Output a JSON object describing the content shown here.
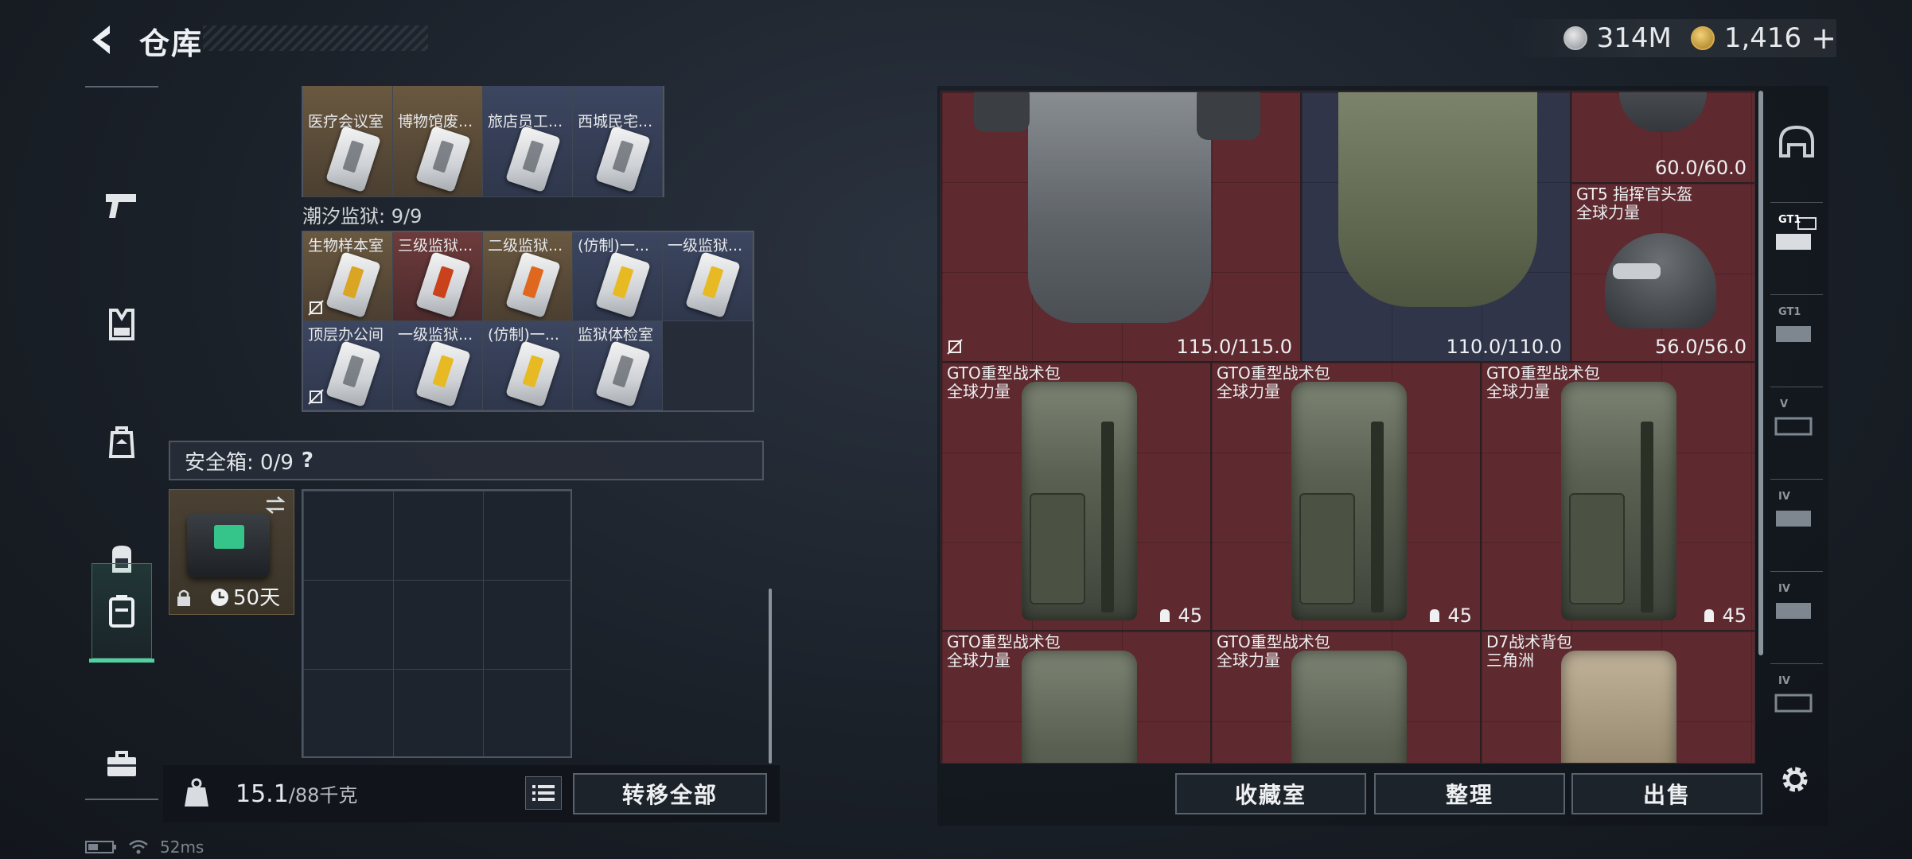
{
  "header": {
    "title": "仓库",
    "currency": [
      {
        "icon": "silver-coin-icon",
        "value": "314M"
      },
      {
        "icon": "gold-coin-icon",
        "value": "1,416"
      },
      {
        "icon": "plus-icon",
        "value": "+"
      }
    ]
  },
  "left_nav": [
    {
      "icon": "pistol-icon"
    },
    {
      "icon": "vest-icon"
    },
    {
      "icon": "chest-rig-icon"
    },
    {
      "icon": "backpack-icon"
    },
    {
      "icon": "safebox-icon",
      "active": true
    },
    {
      "icon": "toolbox-icon"
    }
  ],
  "keycards_top": {
    "names": [
      "医疗会议室",
      "博物馆废...",
      "旅店员工...",
      "西城民宅..."
    ]
  },
  "prison": {
    "label": "潮汐监狱: 9/9",
    "row1": [
      "生物样本室",
      "三级监狱...",
      "二级监狱...",
      "(仿制)一...",
      "一级监狱..."
    ],
    "row2": [
      "顶层办公间",
      "一级监狱...",
      "(仿制)一...",
      "监狱体检室"
    ]
  },
  "safebox": {
    "label": "安全箱: 0/9",
    "help": "?",
    "timer": "50天"
  },
  "left_bottom": {
    "weight_current": "15.1",
    "weight_max": "/88千克",
    "transfer_all": "转移全部"
  },
  "items": {
    "vest1_dur": "115.0/115.0",
    "vest2_dur": "110.0/110.0",
    "helmet1_dur": "60.0/60.0",
    "helmet2_name": "GT5 指挥官头盔",
    "helmet2_sub": "全球力量",
    "helmet2_dur": "56.0/56.0",
    "bp1_name": "GTO重型战术包",
    "bp1_sub": "全球力量",
    "bp1_cap": "45",
    "bp2_name": "GTO重型战术包",
    "bp2_sub": "全球力量",
    "bp2_cap": "45",
    "bp3_name": "GTO重型战术包",
    "bp3_sub": "全球力量",
    "bp3_cap": "45",
    "bp4_name": "GTO重型战术包",
    "bp4_sub": "全球力量",
    "bp5_name": "GTO重型战术包",
    "bp5_sub": "全球力量",
    "bp6_name": "D7战术背包",
    "bp6_sub": "三角洲"
  },
  "right_tabs": [
    "helmet-icon",
    "GT1",
    "GT1",
    "V",
    "IV",
    "IV",
    "IV"
  ],
  "right_bottom": {
    "collection": "收藏室",
    "sort": "整理",
    "sell": "出售"
  },
  "status": {
    "ping": "52ms"
  },
  "colors": {
    "accent": "#4fd1a1",
    "slot_red": "#5e2a30",
    "slot_blue": "#30354a"
  }
}
